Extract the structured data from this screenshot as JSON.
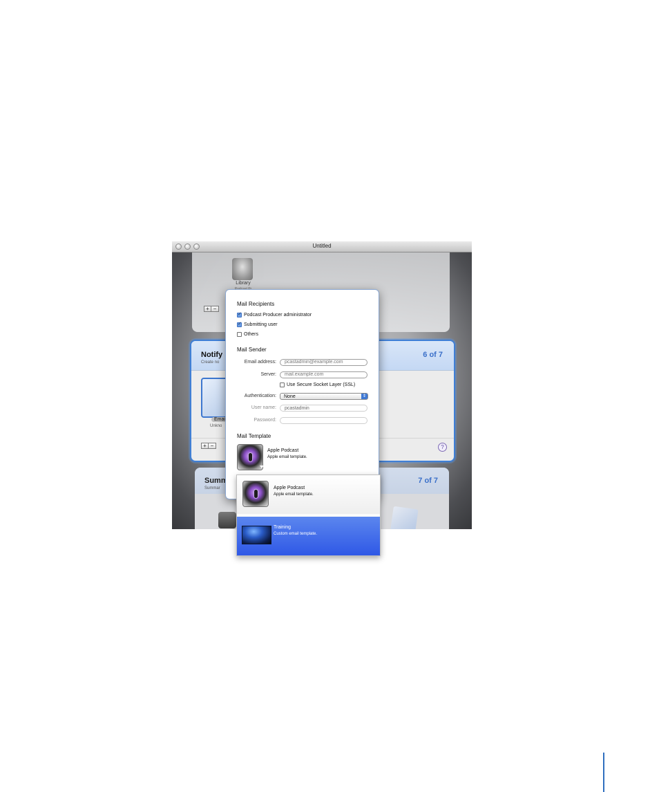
{
  "window": {
    "title": "Untitled"
  },
  "library_card": {
    "label": "Library",
    "sublabel": "Podcast Pr",
    "add_label": "+",
    "remove_label": "−"
  },
  "notify_card": {
    "title": "Notify",
    "subtitle": "Create no",
    "count": "6 of 7",
    "item_label": "Emai",
    "item_sublabel": "Unkno",
    "add_label": "+",
    "remove_label": "−",
    "help_label": "?"
  },
  "summary_card": {
    "title": "Summ",
    "subtitle": "Summar",
    "count": "7 of 7"
  },
  "sheet": {
    "recipients": {
      "title": "Mail Recipients",
      "options": [
        {
          "label": "Podcast Producer administrator",
          "checked": true
        },
        {
          "label": "Submitting user",
          "checked": true
        },
        {
          "label": "Others",
          "checked": false
        }
      ]
    },
    "sender": {
      "title": "Mail Sender",
      "email_label": "Email address:",
      "email_placeholder": "pcastadmin@example.com",
      "server_label": "Server:",
      "server_placeholder": "mail.example.com",
      "ssl_label": "Use Secure Socket Layer (SSL)",
      "ssl_checked": false,
      "auth_label": "Authentication:",
      "auth_value": "None",
      "username_label": "User name:",
      "username_value": "pcastadmin",
      "password_label": "Password:",
      "password_value": ""
    },
    "template": {
      "title": "Mail Template",
      "selected_name": "Apple Podcast",
      "selected_desc": "Apple email template."
    }
  },
  "template_menu": [
    {
      "name": "Apple Podcast",
      "desc": "Apple email template.",
      "icon": "podcast-icon",
      "highlighted": false
    },
    {
      "name": "Training",
      "desc": "Custom email template.",
      "icon": "landscape-icon",
      "highlighted": true
    }
  ],
  "colors": {
    "accent": "#3f7fd6",
    "selection": "#2f58e6",
    "count": "#3a6fc9"
  }
}
